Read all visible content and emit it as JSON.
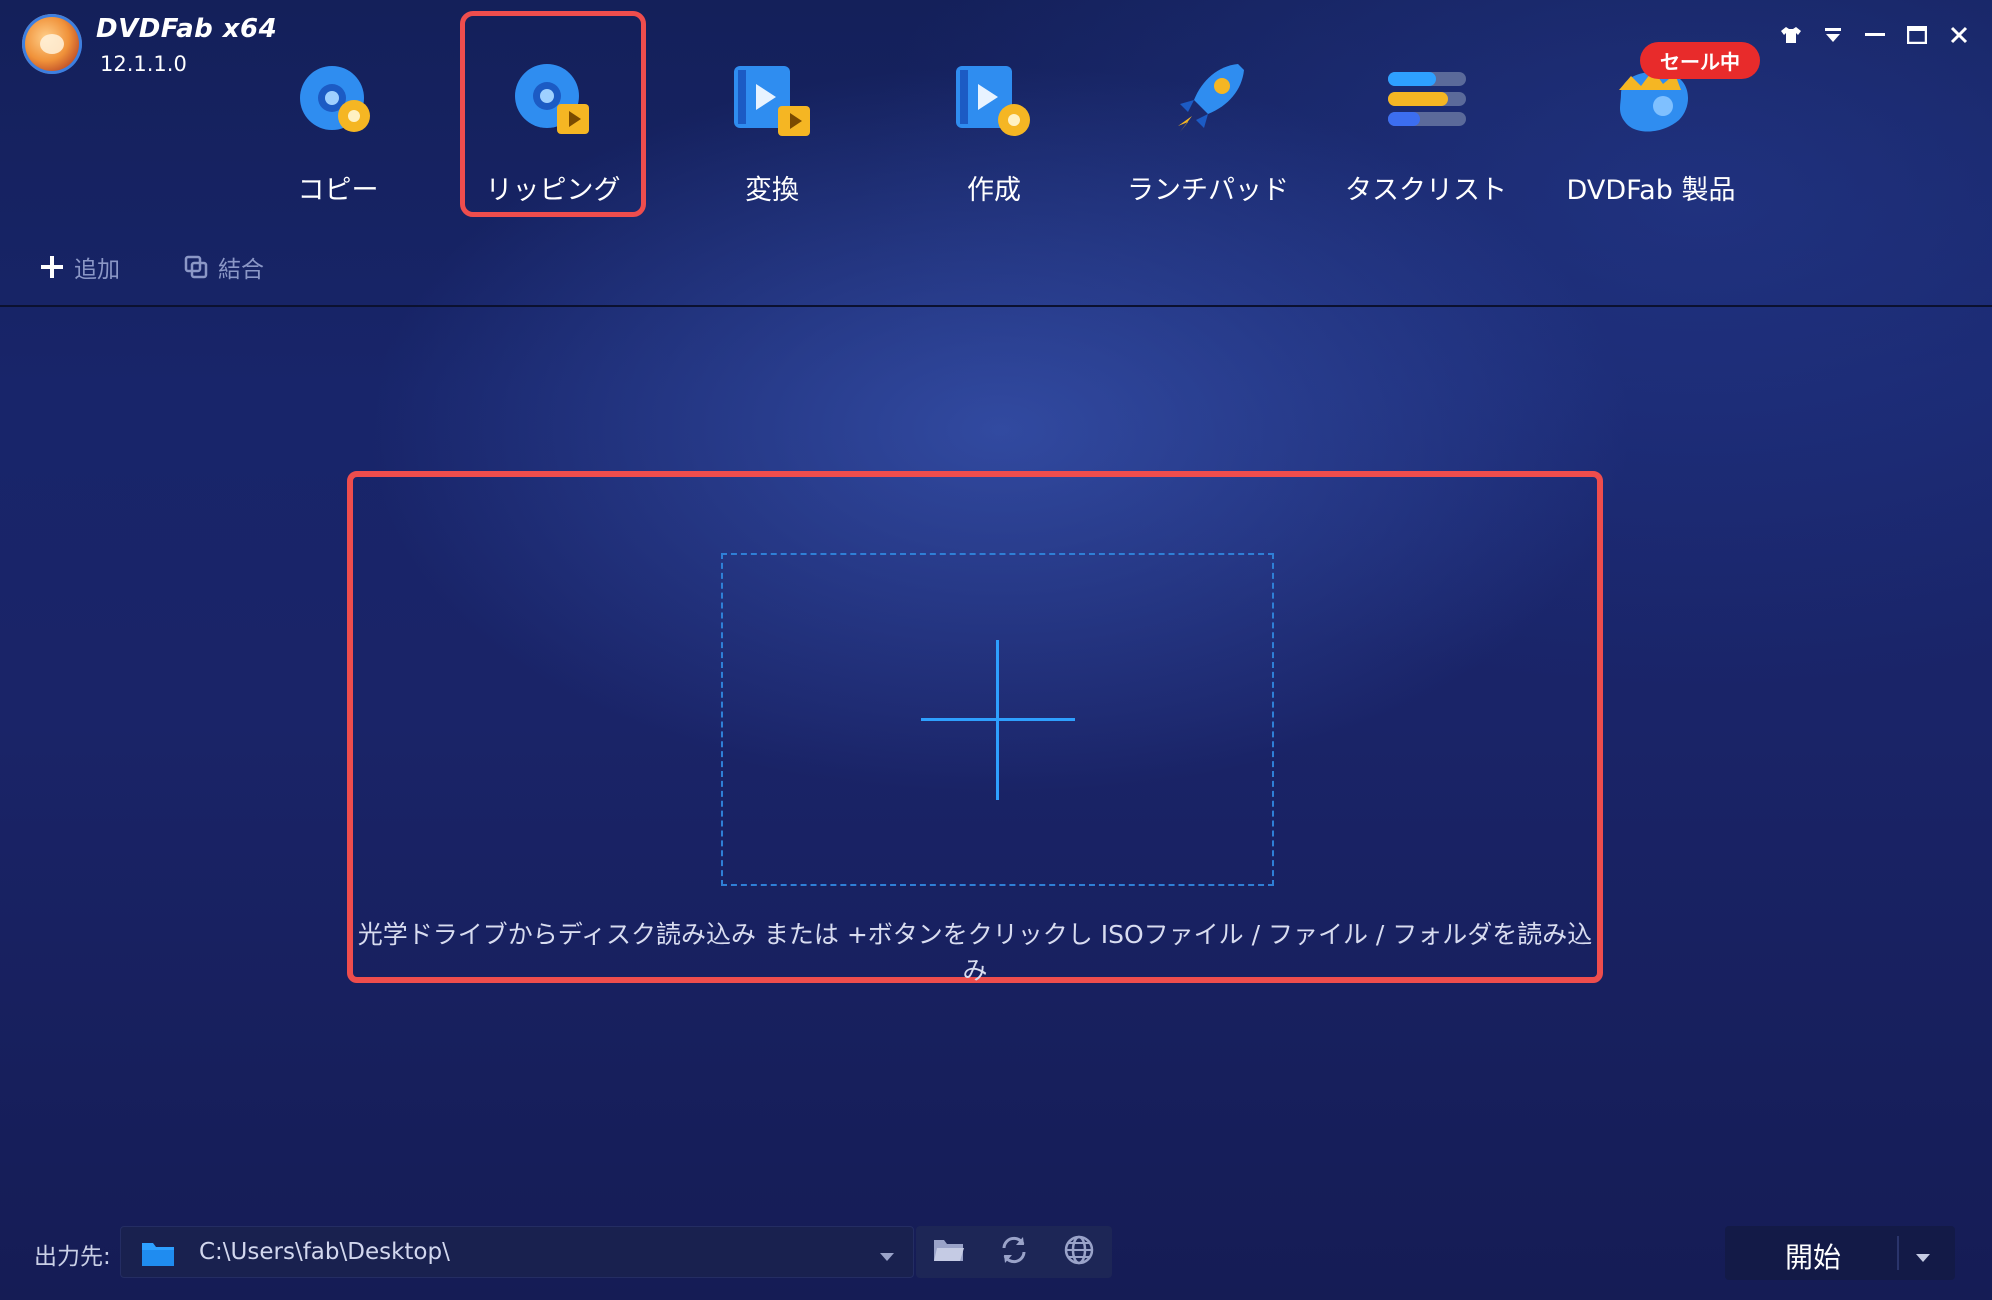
{
  "app": {
    "brand": "DVDFab x64",
    "version": "12.1.1.0"
  },
  "nav": {
    "items": [
      {
        "label": "コピー",
        "icon": "copy-disc-icon"
      },
      {
        "label": "リッピング",
        "icon": "ripper-disc-icon",
        "active": true
      },
      {
        "label": "変換",
        "icon": "converter-icon"
      },
      {
        "label": "作成",
        "icon": "creator-icon"
      },
      {
        "label": "ランチパッド",
        "icon": "launchpad-rocket-icon"
      },
      {
        "label": "タスクリスト",
        "icon": "task-list-icon"
      },
      {
        "label": "DVDFab 製品",
        "icon": "dvdfab-products-icon"
      }
    ],
    "sale_badge": "セール中"
  },
  "toolbar": {
    "add_label": "追加",
    "merge_label": "結合"
  },
  "dropzone": {
    "hint": "光学ドライブからディスク読み込み または +ボタンをクリックし ISOファイル / ファイル / フォルダを読み込み"
  },
  "footer": {
    "output_label": "出力先:",
    "output_path": "C:\\Users\\fab\\Desktop\\",
    "start_label": "開始"
  },
  "colors": {
    "highlight": "#ee4d4d",
    "accent": "#2ea0ff",
    "sale": "#e82b2b"
  }
}
